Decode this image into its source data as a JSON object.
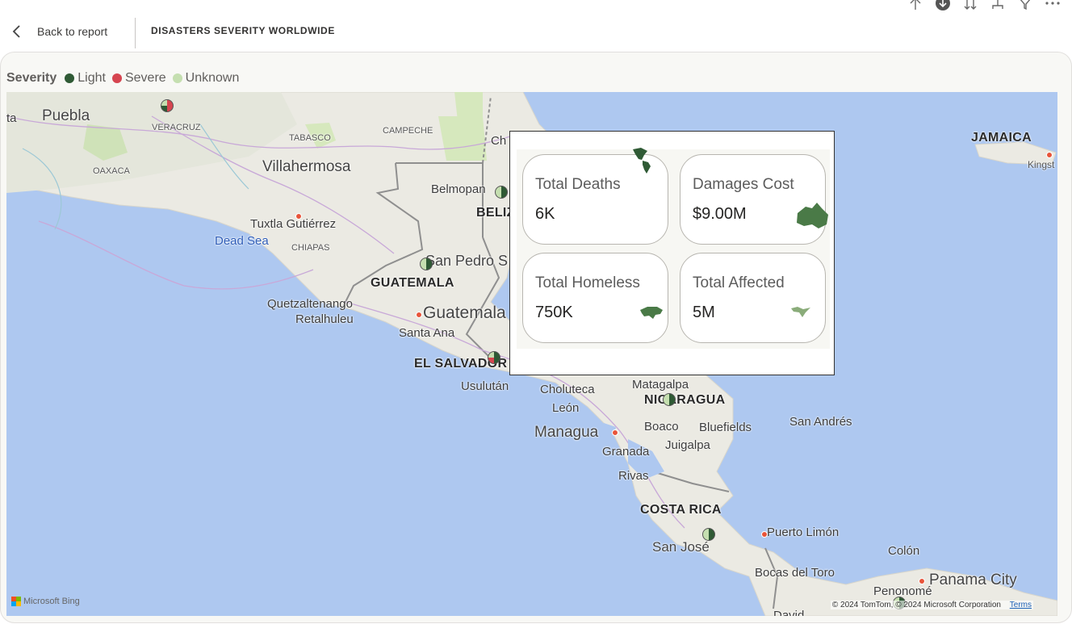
{
  "header": {
    "back_label": "Back to report",
    "title": "DISASTERS SEVERITY WORLDWIDE"
  },
  "toolbar_icons": [
    "arrow-up-icon",
    "download-circle-icon",
    "sort-icon",
    "drill-icon",
    "filter-icon",
    "more-icon"
  ],
  "legend": {
    "label": "Severity",
    "items": [
      {
        "label": "Light",
        "color": "#2f5a35"
      },
      {
        "label": "Severe",
        "color": "#d64550"
      },
      {
        "label": "Unknown",
        "color": "#c5dfb0"
      }
    ]
  },
  "map": {
    "labels": {
      "ta": "ta",
      "puebla": "Puebla",
      "veracruz": "VERACRUZ",
      "tabasco": "TABASCO",
      "campeche": "CAMPECHE",
      "ch": "Ch",
      "oaxaca": "OAXACA",
      "villahermosa": "Villahermosa",
      "belmopan": "Belmopan",
      "beliz": "BELIZ",
      "tuxtla": "Tuxtla Gutiérrez",
      "dead_sea": "Dead Sea",
      "chiapas": "CHIAPAS",
      "san_pedro": "San Pedro S",
      "guatemala_country": "GUATEMALA",
      "quetzaltenango": "Quetzaltenango",
      "retalhuleu": "Retalhuleu",
      "guatemala_city": "Guatemala",
      "santa_ana": "Santa Ana",
      "el_salvador": "EL SALVADOR",
      "usulutan": "Usulután",
      "choluteca": "Choluteca",
      "matagalpa": "Matagalpa",
      "nicaragua": "NICARAGUA",
      "leon": "León",
      "managua": "Managua",
      "boaco": "Boaco",
      "bluefields": "Bluefields",
      "juigalpa": "Juigalpa",
      "granada": "Granada",
      "rivas": "Rivas",
      "san_andres": "San Andrés",
      "costa_rica": "COSTA RICA",
      "puerto_limon": "Puerto Limón",
      "san_jose": "San José",
      "colon": "Colón",
      "bocas": "Bocas del Toro",
      "panama_city": "Panama City",
      "penonome": "Penonomé",
      "jamaica": "JAMAICA",
      "kingst": "Kingst",
      "david": "David"
    },
    "attribution": {
      "bing": "Microsoft Bing",
      "copyright": "© 2024 TomTom, © 2024 Microsoft Corporation",
      "terms": "Terms"
    }
  },
  "tooltip": {
    "cards": [
      {
        "label": "Total Deaths",
        "value": "6K",
        "icon": "americas-icon"
      },
      {
        "label": "Damages Cost",
        "value": "$9.00M",
        "icon": "australia-icon"
      },
      {
        "label": "Total Homeless",
        "value": "750K",
        "icon": "asia-icon"
      },
      {
        "label": "Total Affected",
        "value": "5M",
        "icon": "south-america-icon"
      }
    ]
  }
}
